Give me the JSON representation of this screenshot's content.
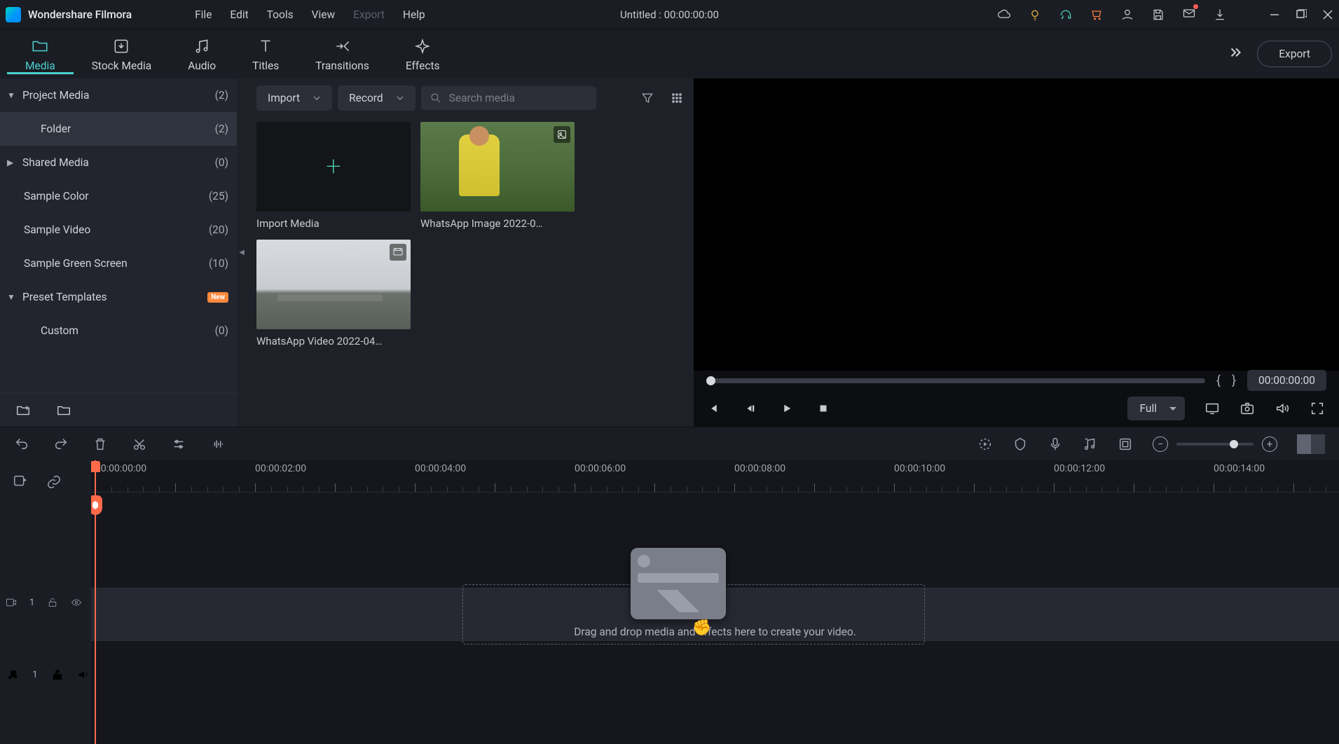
{
  "app": {
    "name": "Wondershare Filmora"
  },
  "menu": {
    "file": "File",
    "edit": "Edit",
    "tools": "Tools",
    "view": "View",
    "export": "Export",
    "help": "Help"
  },
  "titlebar": {
    "project": "Untitled : 00:00:00:00"
  },
  "tabs": {
    "media": "Media",
    "stock": "Stock Media",
    "audio": "Audio",
    "titles": "Titles",
    "transitions": "Transitions",
    "effects": "Effects",
    "export_btn": "Export"
  },
  "sidebar": {
    "project_media": {
      "label": "Project Media",
      "count": "(2)"
    },
    "folder": {
      "label": "Folder",
      "count": "(2)"
    },
    "shared": {
      "label": "Shared Media",
      "count": "(0)"
    },
    "sample_color": {
      "label": "Sample Color",
      "count": "(25)"
    },
    "sample_video": {
      "label": "Sample Video",
      "count": "(20)"
    },
    "sample_green": {
      "label": "Sample Green Screen",
      "count": "(10)"
    },
    "preset": {
      "label": "Preset Templates",
      "badge": "New"
    },
    "custom": {
      "label": "Custom",
      "count": "(0)"
    }
  },
  "mediabar": {
    "import": "Import",
    "record": "Record",
    "search_placeholder": "Search media"
  },
  "media_items": {
    "import": "Import Media",
    "clip1": "WhatsApp Image 2022-0…",
    "clip2": "WhatsApp Video 2022-04…"
  },
  "preview": {
    "time": "00:00:00:00",
    "quality": "Full"
  },
  "ruler": {
    "t0": "00:00:00:00",
    "t2": "00:00:02:00",
    "t4": "00:00:04:00",
    "t6": "00:00:06:00",
    "t8": "00:00:08:00",
    "t10": "00:00:10:00",
    "t12": "00:00:12:00",
    "t14": "00:00:14:00"
  },
  "tracks": {
    "video": "1",
    "audio": "1"
  },
  "timeline": {
    "drop_hint": "Drag and drop media and effects here to create your video."
  }
}
